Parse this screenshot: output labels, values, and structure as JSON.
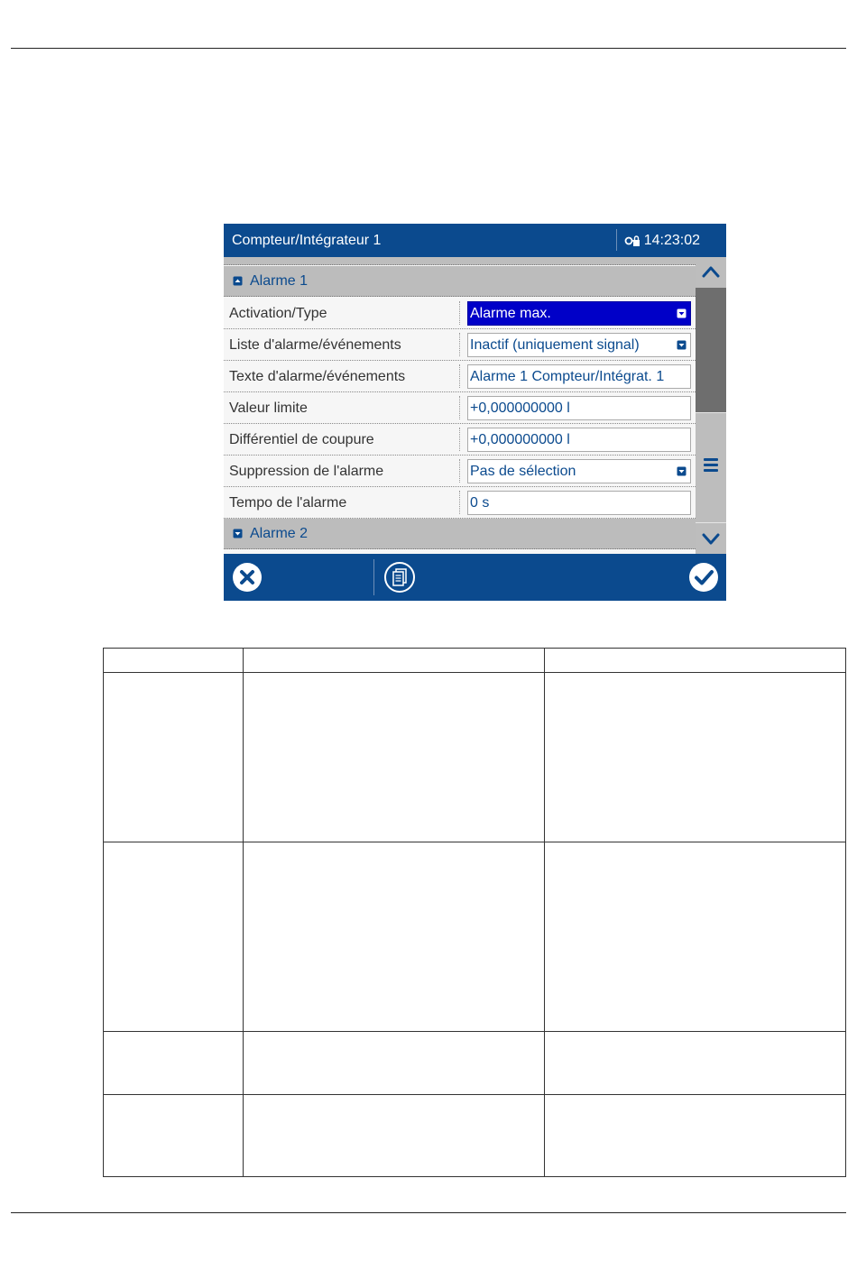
{
  "screen": {
    "title": "Compteur/Intégrateur 1",
    "time": "14:23:02",
    "groups": [
      {
        "label": "Alarme 1",
        "state": "expanded"
      },
      {
        "label": "Alarme 2",
        "state": "collapsed"
      }
    ],
    "rows": [
      {
        "label": "Activation/Type",
        "value": "Alarme max.",
        "kind": "dropdown",
        "selected": true
      },
      {
        "label": "Liste d'alarme/événements",
        "value": "Inactif (uniquement signal)",
        "kind": "dropdown",
        "selected": false
      },
      {
        "label": "Texte d'alarme/événements",
        "value": "Alarme 1 Compteur/Intégrat. 1",
        "kind": "text",
        "selected": false
      },
      {
        "label": "Valeur limite",
        "value": "+0,000000000 l",
        "kind": "text",
        "selected": false
      },
      {
        "label": "Différentiel de coupure",
        "value": "+0,000000000 l",
        "kind": "text",
        "selected": false
      },
      {
        "label": "Suppression de l'alarme",
        "value": "Pas de sélection",
        "kind": "dropdown",
        "selected": false
      },
      {
        "label": "Tempo de l'alarme",
        "value": "0 s",
        "kind": "text",
        "selected": false
      }
    ],
    "icons": {
      "lock": "lock-icon",
      "scroll_up": "chevron-up-icon",
      "menu": "menu-icon",
      "scroll_down": "chevron-down-icon",
      "cancel": "cancel-icon",
      "document": "document-icon",
      "confirm": "checkmark-icon"
    }
  },
  "colors": {
    "header_blue": "#0b4a8e",
    "selection_blue": "#0000c8",
    "group_gray": "#bcbcbc",
    "scrollbar_gray": "#bdbdbd",
    "scroll_thumb": "#6e6e6e"
  }
}
